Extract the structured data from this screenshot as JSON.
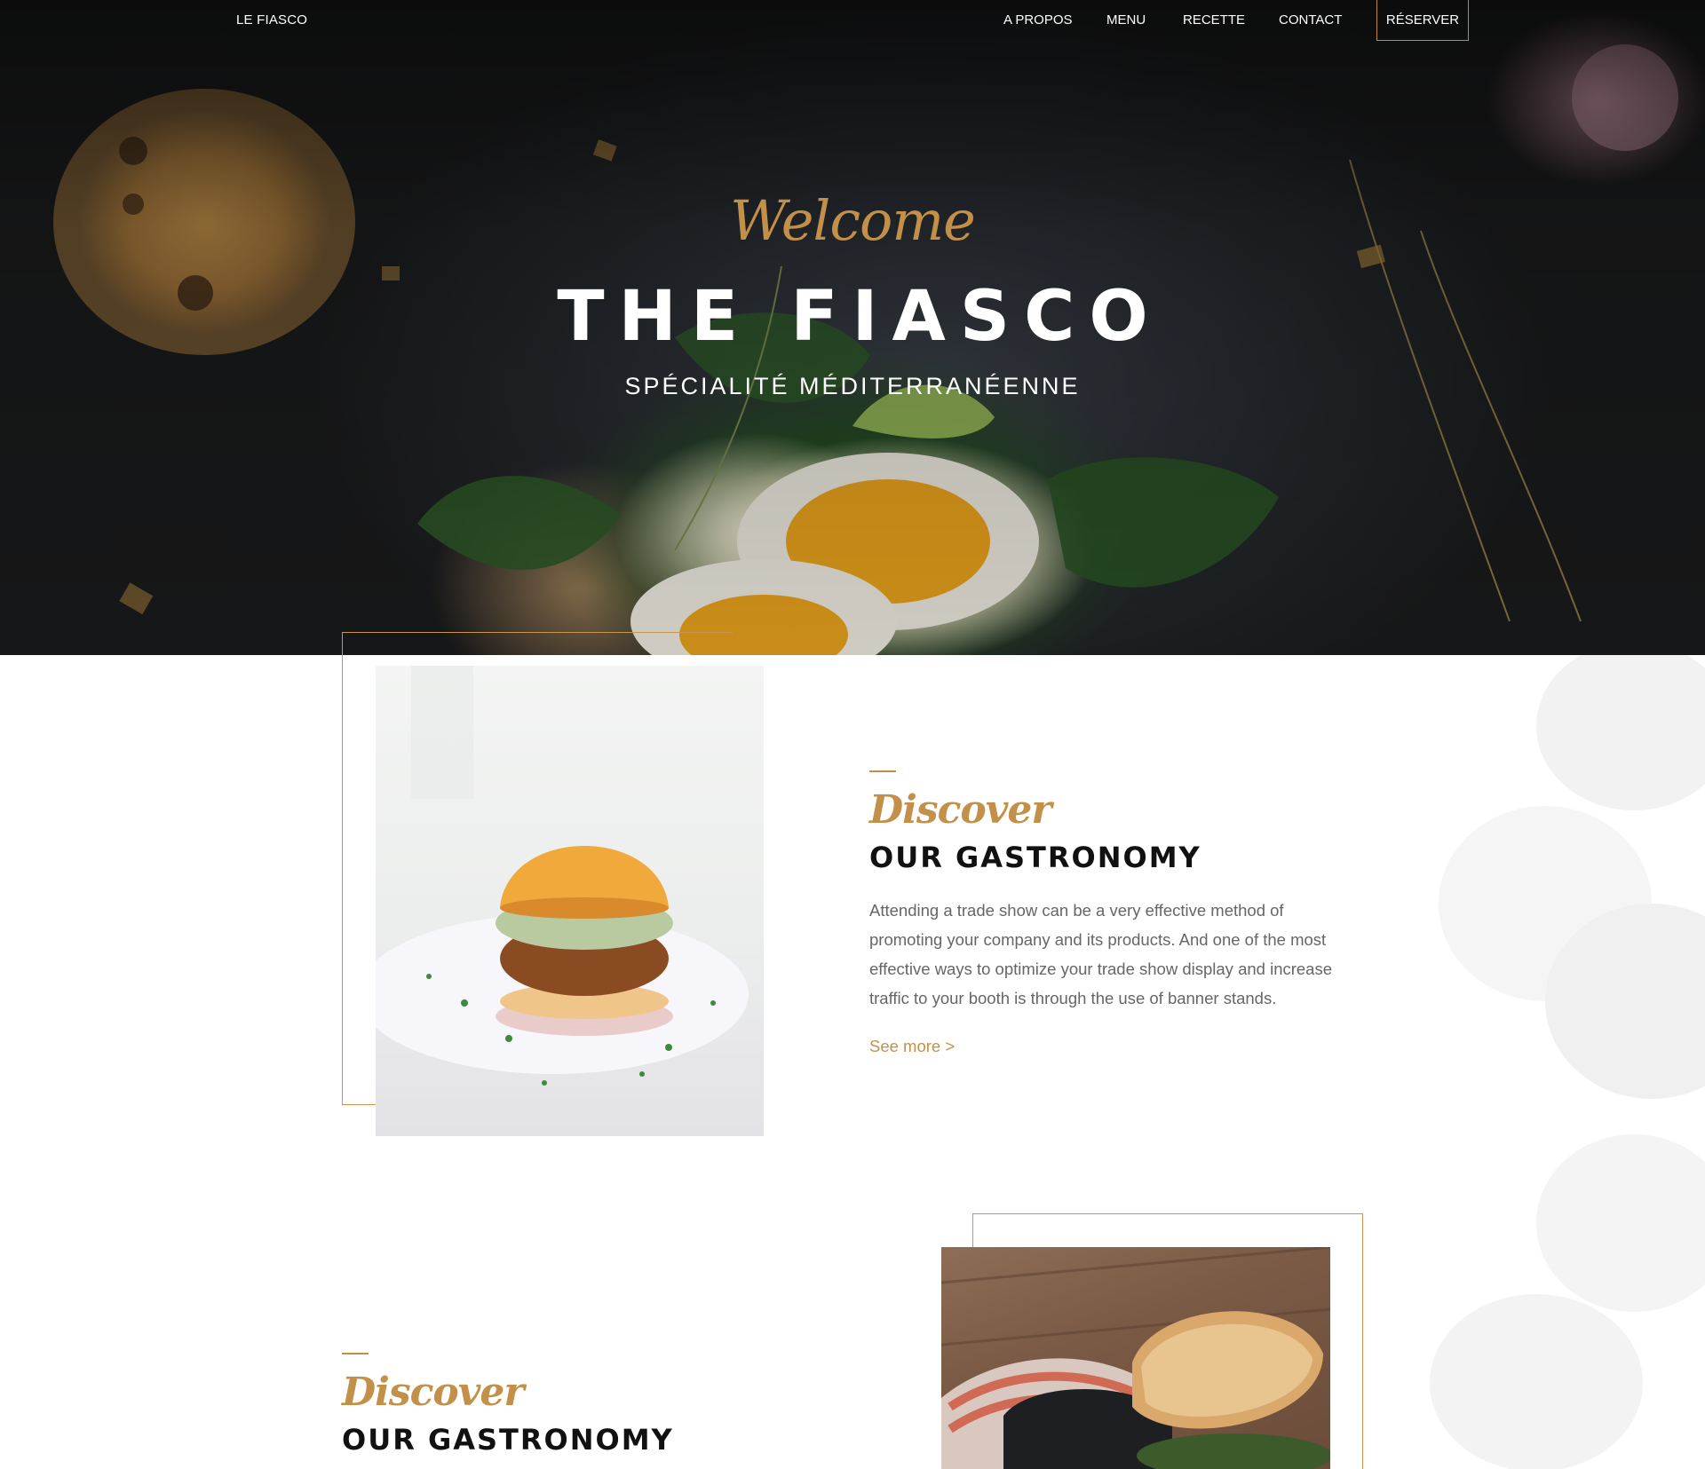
{
  "nav": {
    "brand": "LE FIASCO",
    "links": [
      "A PROPOS",
      "MENU",
      "RECETTE",
      "CONTACT"
    ],
    "cta": "RÉSERVER"
  },
  "hero": {
    "script": "Welcome",
    "title": "THE FIASCO",
    "subtitle": "SPÉCIALITÉ MÉDITERRANÉENNE"
  },
  "sections": [
    {
      "script": "Discover",
      "title": "OUR GASTRONOMY",
      "text": "Attending a trade show can be a very effective method of promoting your company and its products. And one of the most effective ways to optimize your trade show display and increase traffic to your booth is through the use of banner stands.",
      "link": "See more >",
      "image": "burger-photo"
    },
    {
      "script": "Discover",
      "title": "OUR GASTRONOMY",
      "image": "toast-photo"
    }
  ],
  "colors": {
    "accent": "#c39049",
    "frame": "#c9964f",
    "heading": "#111111",
    "body_text": "#666666"
  }
}
